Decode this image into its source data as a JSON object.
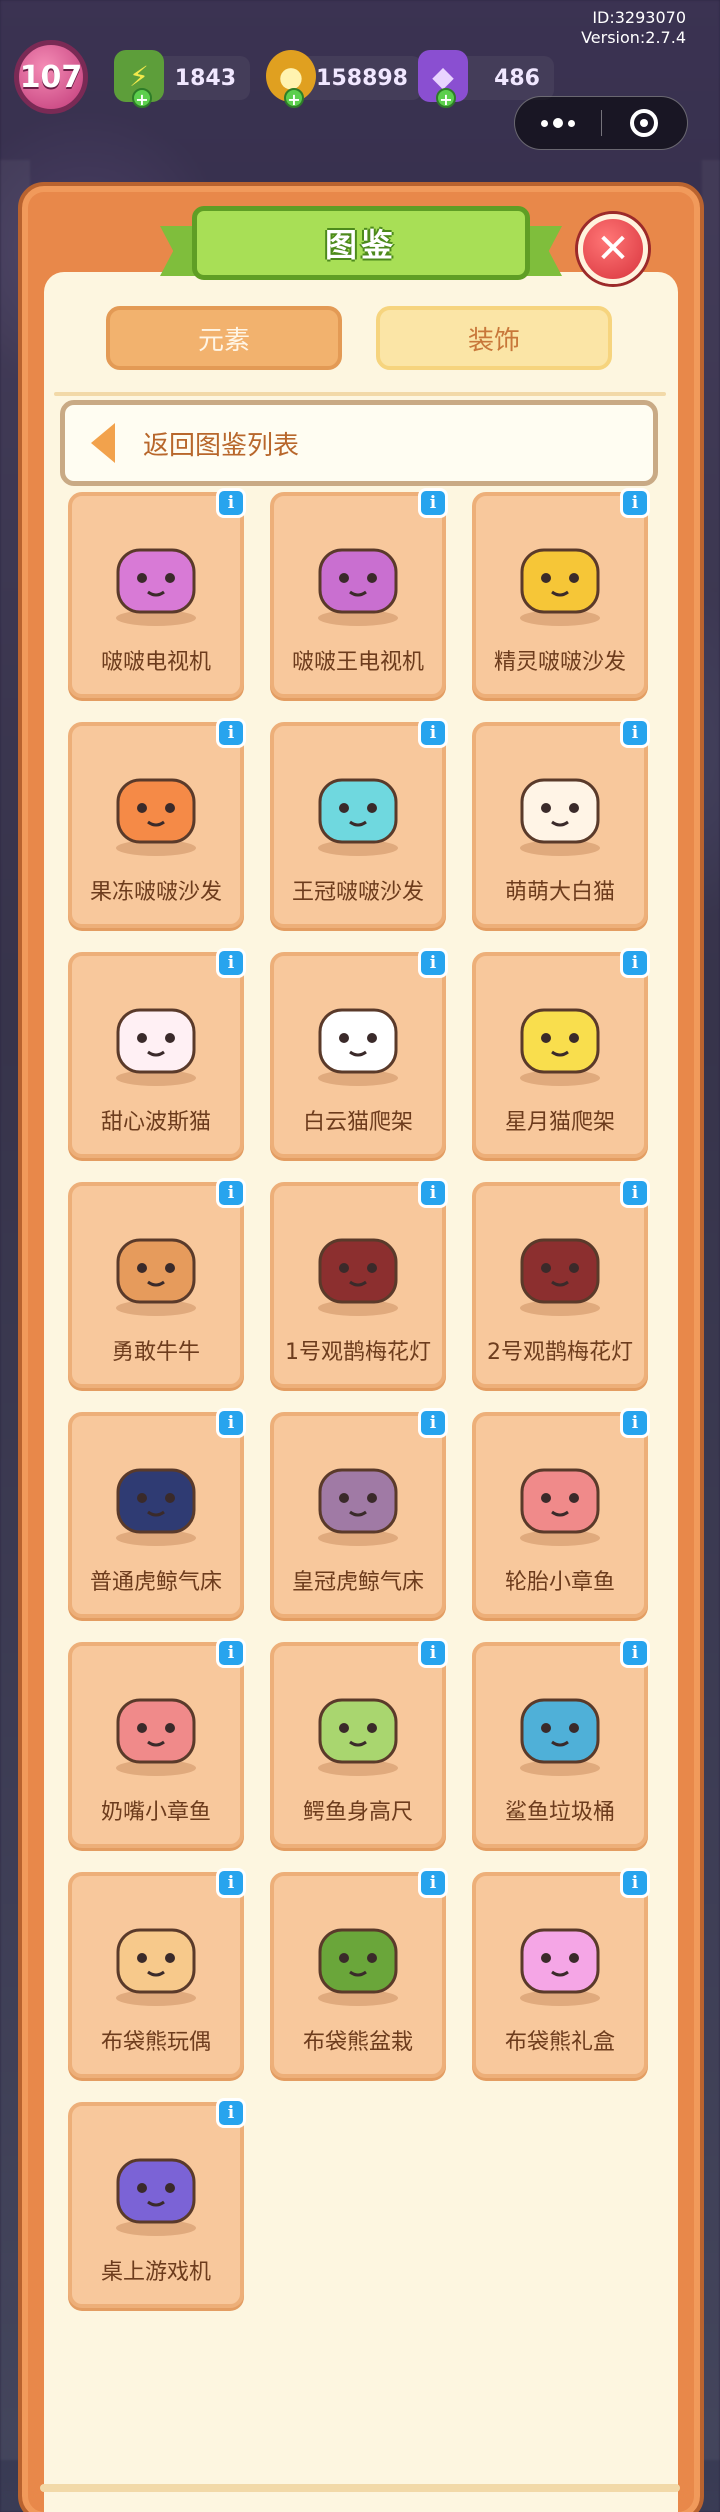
{
  "system": {
    "id_text": "ID:3293070",
    "version_text": "Version:2.7.4"
  },
  "hud": {
    "level": "107",
    "energy": "1843",
    "coins": "158898",
    "gems": "486"
  },
  "panel": {
    "title": "图鉴",
    "close_symbol": "✕",
    "tabs": [
      {
        "label": "元素",
        "active": false
      },
      {
        "label": "装饰",
        "active": true
      }
    ],
    "back_label": "返回图鉴列表",
    "info_symbol": "i"
  },
  "items": [
    {
      "label": "啵啵电视机",
      "icon": "pink-tv-robot-icon",
      "color": "#d87ad6"
    },
    {
      "label": "啵啵王电视机",
      "icon": "crown-tv-robot-icon",
      "color": "#c96fd0"
    },
    {
      "label": "精灵啵啵沙发",
      "icon": "yellow-jelly-sofa-icon",
      "color": "#f6c637"
    },
    {
      "label": "果冻啵啵沙发",
      "icon": "orange-jelly-sofa-icon",
      "color": "#f58a47"
    },
    {
      "label": "王冠啵啵沙发",
      "icon": "cyan-crown-sofa-icon",
      "color": "#6fd8df"
    },
    {
      "label": "萌萌大白猫",
      "icon": "white-cat-icon",
      "color": "#fff4e6"
    },
    {
      "label": "甜心波斯猫",
      "icon": "persian-cat-icon",
      "color": "#fff0f4"
    },
    {
      "label": "白云猫爬架",
      "icon": "cloud-cat-tree-icon",
      "color": "#ffffff"
    },
    {
      "label": "星月猫爬架",
      "icon": "star-moon-cat-tree-icon",
      "color": "#f9de4d"
    },
    {
      "label": "勇敢牛牛",
      "icon": "brave-cow-icon",
      "color": "#e69b5c"
    },
    {
      "label": "1号观鹊梅花灯",
      "icon": "plum-lamp-1-icon",
      "color": "#8c2f2f"
    },
    {
      "label": "2号观鹊梅花灯",
      "icon": "plum-lamp-2-icon",
      "color": "#8c2f2f"
    },
    {
      "label": "普通虎鲸气床",
      "icon": "orca-float-icon",
      "color": "#2f3b73"
    },
    {
      "label": "皇冠虎鲸气床",
      "icon": "crown-orca-float-icon",
      "color": "#a07aa5"
    },
    {
      "label": "轮胎小章鱼",
      "icon": "tire-octopus-icon",
      "color": "#f08a8a"
    },
    {
      "label": "奶嘴小章鱼",
      "icon": "pacifier-octopus-icon",
      "color": "#f08a8a"
    },
    {
      "label": "鳄鱼身高尺",
      "icon": "crocodile-ruler-icon",
      "color": "#a9d66f"
    },
    {
      "label": "鲨鱼垃圾桶",
      "icon": "shark-bin-icon",
      "color": "#4fb0d8"
    },
    {
      "label": "布袋熊玩偶",
      "icon": "wombat-doll-icon",
      "color": "#f7c98b"
    },
    {
      "label": "布袋熊盆栽",
      "icon": "wombat-plant-icon",
      "color": "#6aa63a"
    },
    {
      "label": "布袋熊礼盒",
      "icon": "wombat-gift-icon",
      "color": "#f5a6e6"
    },
    {
      "label": "桌上游戏机",
      "icon": "table-game-console-icon",
      "color": "#7b63d6"
    }
  ]
}
